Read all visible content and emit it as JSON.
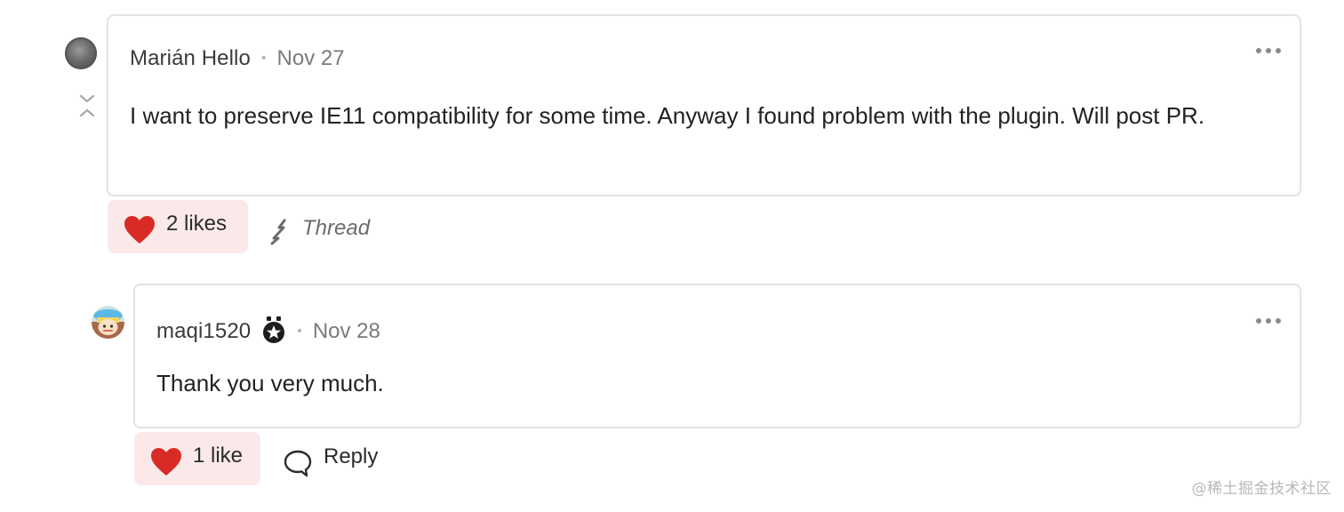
{
  "comments": [
    {
      "author": "Marián Hello",
      "separator": "•",
      "date": "Nov 27",
      "body": "I want to preserve IE11 compatibility for some time. Anyway I found problem with the plugin. Will post PR.",
      "likes_label": "2 likes",
      "secondary_action_label": "Thread",
      "avatar_icon": "avatar-gray-photo",
      "menu_icon": "more-dots-icon"
    },
    {
      "author": "maqi1520",
      "separator": "•",
      "date": "Nov 28",
      "body": "Thank you very much.",
      "likes_label": "1 like",
      "secondary_action_label": "Reply",
      "avatar_icon": "avatar-cartoon-hat",
      "badge_icon": "star-medal-icon",
      "menu_icon": "more-dots-icon"
    }
  ],
  "colors": {
    "like_bg": "#fae9e8",
    "heart": "#d92b25",
    "card_border": "#e3e3e3",
    "muted_text": "#7b7b7b"
  },
  "watermark": "@稀土掘金技术社区"
}
